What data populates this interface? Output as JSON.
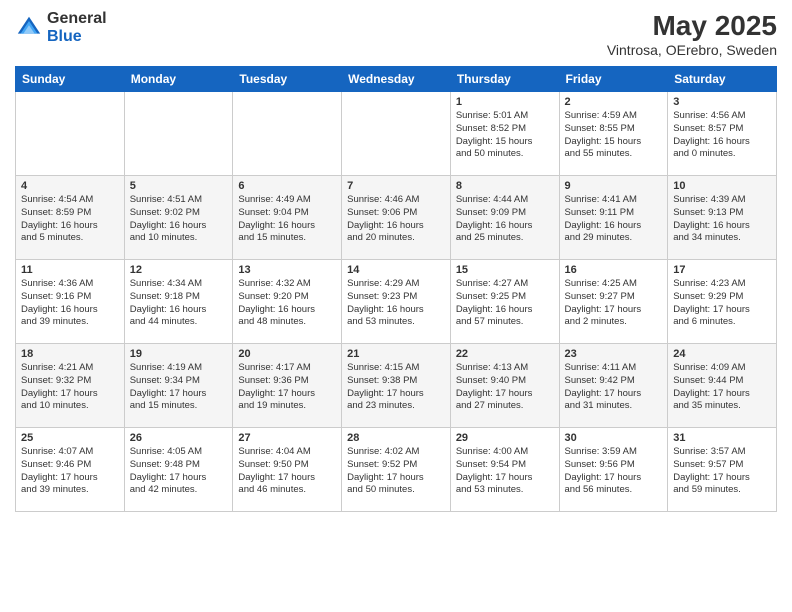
{
  "logo": {
    "general": "General",
    "blue": "Blue"
  },
  "title": "May 2025",
  "subtitle": "Vintrosa, OErebro, Sweden",
  "days_of_week": [
    "Sunday",
    "Monday",
    "Tuesday",
    "Wednesday",
    "Thursday",
    "Friday",
    "Saturday"
  ],
  "weeks": [
    [
      {
        "day": "",
        "info": ""
      },
      {
        "day": "",
        "info": ""
      },
      {
        "day": "",
        "info": ""
      },
      {
        "day": "",
        "info": ""
      },
      {
        "day": "1",
        "info": "Sunrise: 5:01 AM\nSunset: 8:52 PM\nDaylight: 15 hours\nand 50 minutes."
      },
      {
        "day": "2",
        "info": "Sunrise: 4:59 AM\nSunset: 8:55 PM\nDaylight: 15 hours\nand 55 minutes."
      },
      {
        "day": "3",
        "info": "Sunrise: 4:56 AM\nSunset: 8:57 PM\nDaylight: 16 hours\nand 0 minutes."
      }
    ],
    [
      {
        "day": "4",
        "info": "Sunrise: 4:54 AM\nSunset: 8:59 PM\nDaylight: 16 hours\nand 5 minutes."
      },
      {
        "day": "5",
        "info": "Sunrise: 4:51 AM\nSunset: 9:02 PM\nDaylight: 16 hours\nand 10 minutes."
      },
      {
        "day": "6",
        "info": "Sunrise: 4:49 AM\nSunset: 9:04 PM\nDaylight: 16 hours\nand 15 minutes."
      },
      {
        "day": "7",
        "info": "Sunrise: 4:46 AM\nSunset: 9:06 PM\nDaylight: 16 hours\nand 20 minutes."
      },
      {
        "day": "8",
        "info": "Sunrise: 4:44 AM\nSunset: 9:09 PM\nDaylight: 16 hours\nand 25 minutes."
      },
      {
        "day": "9",
        "info": "Sunrise: 4:41 AM\nSunset: 9:11 PM\nDaylight: 16 hours\nand 29 minutes."
      },
      {
        "day": "10",
        "info": "Sunrise: 4:39 AM\nSunset: 9:13 PM\nDaylight: 16 hours\nand 34 minutes."
      }
    ],
    [
      {
        "day": "11",
        "info": "Sunrise: 4:36 AM\nSunset: 9:16 PM\nDaylight: 16 hours\nand 39 minutes."
      },
      {
        "day": "12",
        "info": "Sunrise: 4:34 AM\nSunset: 9:18 PM\nDaylight: 16 hours\nand 44 minutes."
      },
      {
        "day": "13",
        "info": "Sunrise: 4:32 AM\nSunset: 9:20 PM\nDaylight: 16 hours\nand 48 minutes."
      },
      {
        "day": "14",
        "info": "Sunrise: 4:29 AM\nSunset: 9:23 PM\nDaylight: 16 hours\nand 53 minutes."
      },
      {
        "day": "15",
        "info": "Sunrise: 4:27 AM\nSunset: 9:25 PM\nDaylight: 16 hours\nand 57 minutes."
      },
      {
        "day": "16",
        "info": "Sunrise: 4:25 AM\nSunset: 9:27 PM\nDaylight: 17 hours\nand 2 minutes."
      },
      {
        "day": "17",
        "info": "Sunrise: 4:23 AM\nSunset: 9:29 PM\nDaylight: 17 hours\nand 6 minutes."
      }
    ],
    [
      {
        "day": "18",
        "info": "Sunrise: 4:21 AM\nSunset: 9:32 PM\nDaylight: 17 hours\nand 10 minutes."
      },
      {
        "day": "19",
        "info": "Sunrise: 4:19 AM\nSunset: 9:34 PM\nDaylight: 17 hours\nand 15 minutes."
      },
      {
        "day": "20",
        "info": "Sunrise: 4:17 AM\nSunset: 9:36 PM\nDaylight: 17 hours\nand 19 minutes."
      },
      {
        "day": "21",
        "info": "Sunrise: 4:15 AM\nSunset: 9:38 PM\nDaylight: 17 hours\nand 23 minutes."
      },
      {
        "day": "22",
        "info": "Sunrise: 4:13 AM\nSunset: 9:40 PM\nDaylight: 17 hours\nand 27 minutes."
      },
      {
        "day": "23",
        "info": "Sunrise: 4:11 AM\nSunset: 9:42 PM\nDaylight: 17 hours\nand 31 minutes."
      },
      {
        "day": "24",
        "info": "Sunrise: 4:09 AM\nSunset: 9:44 PM\nDaylight: 17 hours\nand 35 minutes."
      }
    ],
    [
      {
        "day": "25",
        "info": "Sunrise: 4:07 AM\nSunset: 9:46 PM\nDaylight: 17 hours\nand 39 minutes."
      },
      {
        "day": "26",
        "info": "Sunrise: 4:05 AM\nSunset: 9:48 PM\nDaylight: 17 hours\nand 42 minutes."
      },
      {
        "day": "27",
        "info": "Sunrise: 4:04 AM\nSunset: 9:50 PM\nDaylight: 17 hours\nand 46 minutes."
      },
      {
        "day": "28",
        "info": "Sunrise: 4:02 AM\nSunset: 9:52 PM\nDaylight: 17 hours\nand 50 minutes."
      },
      {
        "day": "29",
        "info": "Sunrise: 4:00 AM\nSunset: 9:54 PM\nDaylight: 17 hours\nand 53 minutes."
      },
      {
        "day": "30",
        "info": "Sunrise: 3:59 AM\nSunset: 9:56 PM\nDaylight: 17 hours\nand 56 minutes."
      },
      {
        "day": "31",
        "info": "Sunrise: 3:57 AM\nSunset: 9:57 PM\nDaylight: 17 hours\nand 59 minutes."
      }
    ]
  ]
}
